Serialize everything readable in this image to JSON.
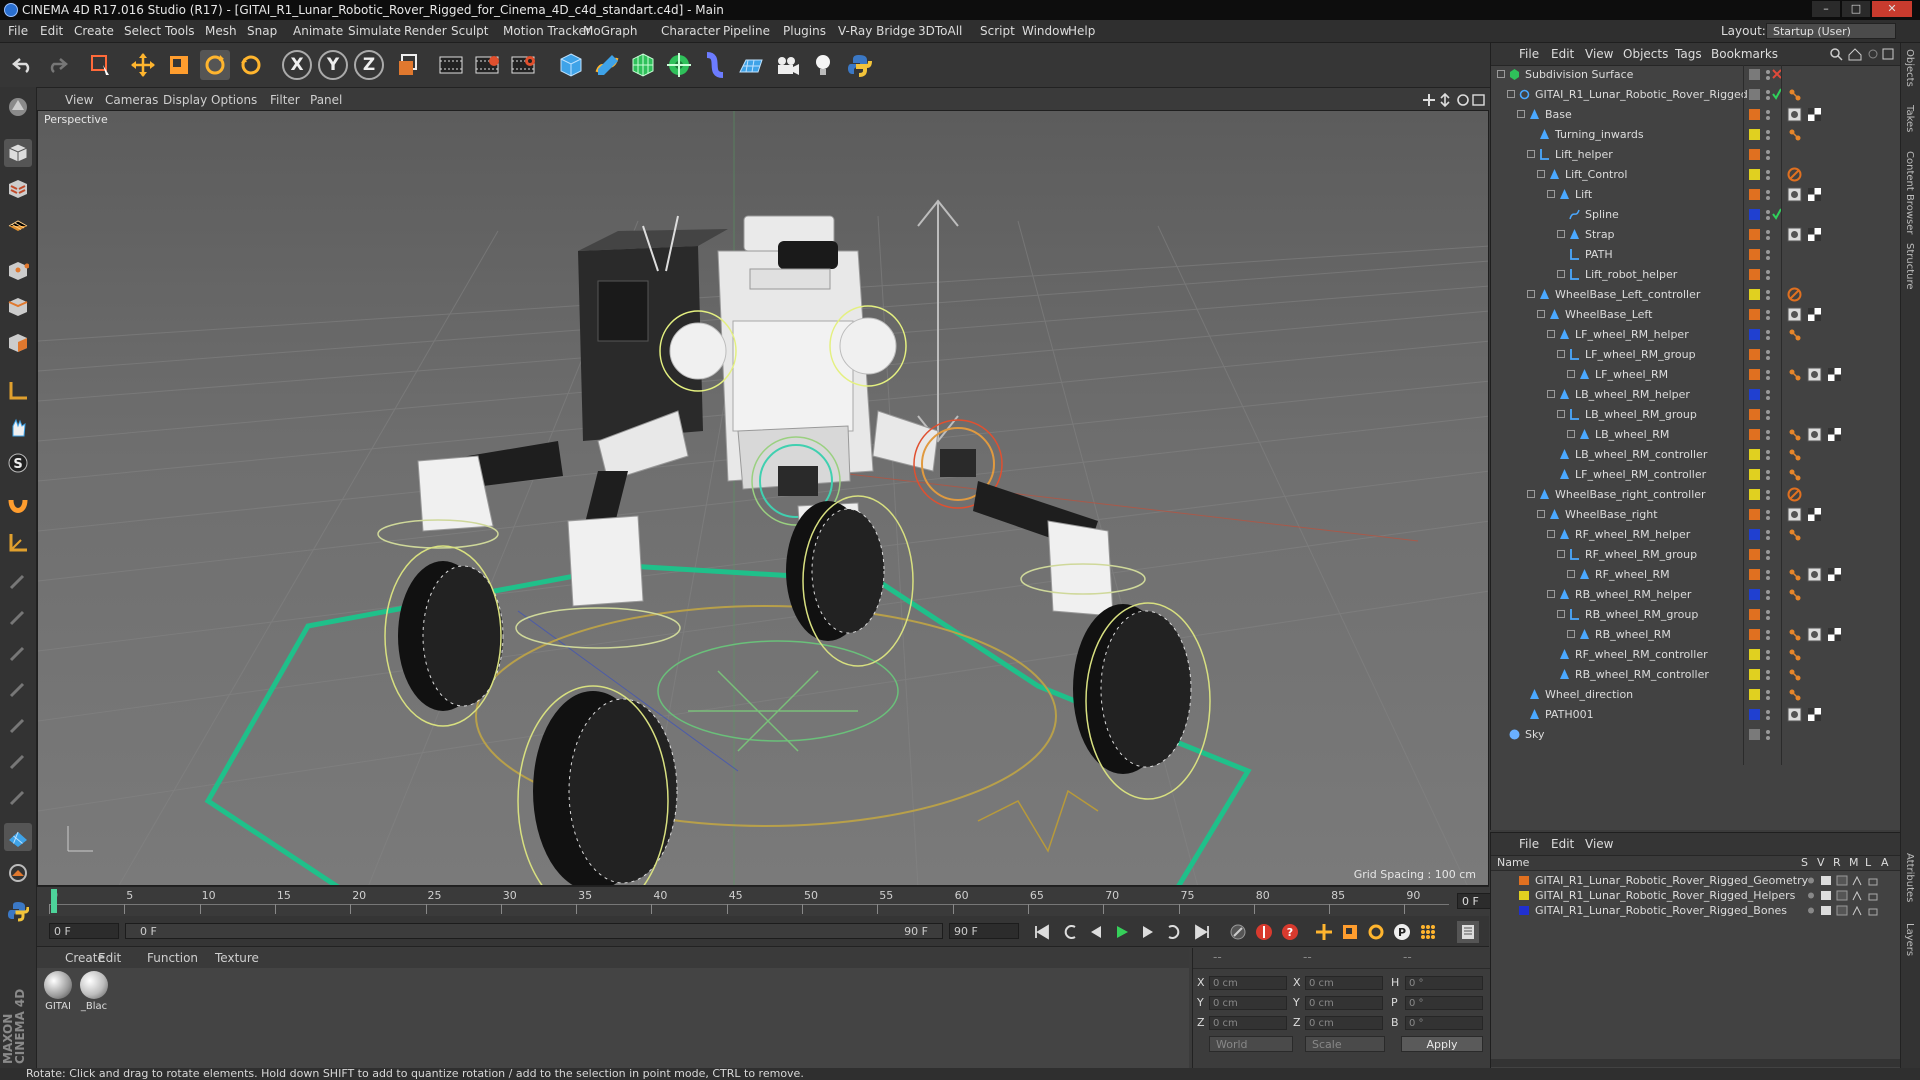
{
  "window": {
    "title": "CINEMA 4D R17.016 Studio (R17) - [GITAI_R1_Lunar_Robotic_Rover_Rigged_for_Cinema_4D_c4d_standart.c4d] - Main",
    "minimize": "–",
    "maximize": "□",
    "close": "✕"
  },
  "menubar": {
    "items": [
      "File",
      "Edit",
      "Create",
      "Select",
      "Tools",
      "Mesh",
      "Snap",
      "Animate",
      "Simulate",
      "Render",
      "Sculpt",
      "Motion Tracker",
      "MoGraph",
      "Character",
      "Pipeline",
      "Plugins",
      "V-Ray Bridge",
      "3DToAll",
      "Script",
      "Window",
      "Help"
    ],
    "layout_label": "Layout:",
    "layout_value": "Startup (User)"
  },
  "toolbar": {
    "axis": [
      "X",
      "Y",
      "Z"
    ]
  },
  "viewport": {
    "menu": [
      "View",
      "Cameras",
      "Display",
      "Options",
      "Filter",
      "Panel"
    ],
    "camera_label": "Perspective",
    "grid_spacing": "Grid Spacing : 100 cm"
  },
  "timeline": {
    "ticks": [
      "0",
      "5",
      "10",
      "15",
      "20",
      "25",
      "30",
      "35",
      "40",
      "45",
      "50",
      "55",
      "60",
      "65",
      "70",
      "75",
      "80",
      "85",
      "90"
    ],
    "current_frame": "0 F"
  },
  "transport": {
    "start_field": "0 F",
    "range_start": "0 F",
    "range_end": "90 F",
    "end_field": "90 F"
  },
  "materials": {
    "menu": [
      "Create",
      "Edit",
      "Function",
      "Texture"
    ],
    "items": [
      {
        "label": "GITAI",
        "color": "#bdbdbd"
      },
      {
        "label": "_Blac",
        "color": "#cfcfcf"
      }
    ]
  },
  "coordinates": {
    "rows": [
      {
        "a": "X",
        "a_val": "0 cm",
        "b": "X",
        "b_val": "0 cm",
        "c": "H",
        "c_val": "0 °"
      },
      {
        "a": "Y",
        "a_val": "0 cm",
        "b": "Y",
        "b_val": "0 cm",
        "c": "P",
        "c_val": "0 °"
      },
      {
        "a": "Z",
        "a_val": "0 cm",
        "b": "Z",
        "b_val": "0 cm",
        "c": "B",
        "c_val": "0 °"
      }
    ],
    "world": "World",
    "scale": "Scale",
    "apply": "Apply",
    "header_dashes": "--"
  },
  "objects": {
    "menu": [
      "File",
      "Edit",
      "View",
      "Objects",
      "Tags",
      "Bookmarks"
    ],
    "tree": [
      {
        "name": "Subdivision Surface",
        "level": 0,
        "icon": "subdiv",
        "sw": "#7a7a7a",
        "exp": true
      },
      {
        "name": "GITAI_R1_Lunar_Robotic_Rover_Rigged",
        "level": 1,
        "icon": "null",
        "sw": "#7a7a7a",
        "exp": true
      },
      {
        "name": "Base",
        "level": 2,
        "icon": "bone",
        "sw": "#e07020",
        "exp": true
      },
      {
        "name": "Turning_inwards",
        "level": 3,
        "icon": "bone",
        "sw": "#e0d020",
        "exp": false
      },
      {
        "name": "Lift_helper",
        "level": 3,
        "icon": "null2",
        "sw": "#e07020",
        "exp": true
      },
      {
        "name": "Lift_Control",
        "level": 4,
        "icon": "bone",
        "sw": "#e0d020",
        "exp": true
      },
      {
        "name": "Lift",
        "level": 5,
        "icon": "bone",
        "sw": "#e07020",
        "exp": true
      },
      {
        "name": "Spline",
        "level": 6,
        "icon": "spline",
        "sw": "#2040d0",
        "exp": false
      },
      {
        "name": "Strap",
        "level": 6,
        "icon": "bone",
        "sw": "#e07020",
        "exp": true
      },
      {
        "name": "PATH",
        "level": 6,
        "icon": "null2",
        "sw": "#e07020",
        "exp": false
      },
      {
        "name": "Lift_robot_helper",
        "level": 6,
        "icon": "null2",
        "sw": "#e07020",
        "exp": true
      },
      {
        "name": "WheelBase_Left_controller",
        "level": 3,
        "icon": "bone",
        "sw": "#e0d020",
        "exp": true
      },
      {
        "name": "WheelBase_Left",
        "level": 4,
        "icon": "bone",
        "sw": "#e07020",
        "exp": true
      },
      {
        "name": "LF_wheel_RM_helper",
        "level": 5,
        "icon": "bone",
        "sw": "#2040d0",
        "exp": true
      },
      {
        "name": "LF_wheel_RM_group",
        "level": 6,
        "icon": "null2",
        "sw": "#e07020",
        "exp": true
      },
      {
        "name": "LF_wheel_RM",
        "level": 7,
        "icon": "bone",
        "sw": "#e07020",
        "exp": true
      },
      {
        "name": "LB_wheel_RM_helper",
        "level": 5,
        "icon": "bone",
        "sw": "#2040d0",
        "exp": true
      },
      {
        "name": "LB_wheel_RM_group",
        "level": 6,
        "icon": "null2",
        "sw": "#e07020",
        "exp": true
      },
      {
        "name": "LB_wheel_RM",
        "level": 7,
        "icon": "bone",
        "sw": "#e07020",
        "exp": true
      },
      {
        "name": "LB_wheel_RM_controller",
        "level": 5,
        "icon": "bone",
        "sw": "#e0d020",
        "exp": false
      },
      {
        "name": "LF_wheel_RM_controller",
        "level": 5,
        "icon": "bone",
        "sw": "#e0d020",
        "exp": false
      },
      {
        "name": "WheelBase_right_controller",
        "level": 3,
        "icon": "bone",
        "sw": "#e0d020",
        "exp": true
      },
      {
        "name": "WheelBase_right",
        "level": 4,
        "icon": "bone",
        "sw": "#e07020",
        "exp": true
      },
      {
        "name": "RF_wheel_RM_helper",
        "level": 5,
        "icon": "bone",
        "sw": "#2040d0",
        "exp": true
      },
      {
        "name": "RF_wheel_RM_group",
        "level": 6,
        "icon": "null2",
        "sw": "#e07020",
        "exp": true
      },
      {
        "name": "RF_wheel_RM",
        "level": 7,
        "icon": "bone",
        "sw": "#e07020",
        "exp": true
      },
      {
        "name": "RB_wheel_RM_helper",
        "level": 5,
        "icon": "bone",
        "sw": "#2040d0",
        "exp": true
      },
      {
        "name": "RB_wheel_RM_group",
        "level": 6,
        "icon": "null2",
        "sw": "#e07020",
        "exp": true
      },
      {
        "name": "RB_wheel_RM",
        "level": 7,
        "icon": "bone",
        "sw": "#e07020",
        "exp": true
      },
      {
        "name": "RF_wheel_RM_controller",
        "level": 5,
        "icon": "bone",
        "sw": "#e0d020",
        "exp": false
      },
      {
        "name": "RB_wheel_RM_controller",
        "level": 5,
        "icon": "bone",
        "sw": "#e0d020",
        "exp": false
      },
      {
        "name": "Wheel_direction",
        "level": 2,
        "icon": "bone",
        "sw": "#e0d020",
        "exp": false
      },
      {
        "name": "PATH001",
        "level": 2,
        "icon": "bone",
        "sw": "#2040d0",
        "exp": false
      },
      {
        "name": "Sky",
        "level": 0,
        "icon": "sky",
        "sw": "#7a7a7a",
        "exp": false
      }
    ]
  },
  "layers": {
    "menu": [
      "File",
      "Edit",
      "View"
    ],
    "header_name": "Name",
    "header_cols": [
      "S",
      "V",
      "R",
      "M",
      "L",
      "A"
    ],
    "items": [
      {
        "name": "GITAI_R1_Lunar_Robotic_Rover_Rigged_Geometry",
        "color": "#e07020"
      },
      {
        "name": "GITAI_R1_Lunar_Robotic_Rover_Rigged_Helpers",
        "color": "#e0d020"
      },
      {
        "name": "GITAI_R1_Lunar_Robotic_Rover_Rigged_Bones",
        "color": "#2030d0"
      }
    ]
  },
  "right_tabs": [
    "Objects",
    "Takes",
    "Content Browser",
    "Structure",
    "Attributes",
    "Layers"
  ],
  "status": "Rotate: Click and drag to rotate elements. Hold down SHIFT to add to quantize rotation / add to the selection in point mode, CTRL to remove.",
  "brand": "MAXON CINEMA 4D",
  "colors": {
    "bg": "#3b3b3b",
    "viewport": "#6e6e6e",
    "accent": "#2a6fd0",
    "close": "#c83b2e"
  }
}
